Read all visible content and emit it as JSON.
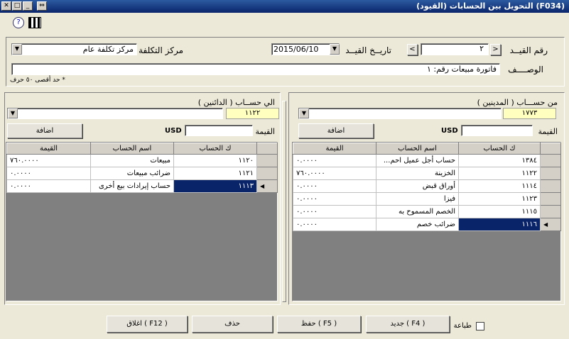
{
  "window": {
    "title": "(F034)  التحويل بين الحسابات (القيود)"
  },
  "header": {
    "entry_no_label": "رقم القيــد",
    "entry_no": "٢",
    "entry_date_label": "تاريــخ القيــد",
    "entry_date": "2015/06/10",
    "cost_center_label": "مركز التكلفة",
    "cost_center": "مركز تكلفة عام",
    "desc_label": "الوصــــف",
    "desc": "فاتورة مبيعات رقم: ١",
    "max_note": "* حد أقصى ٥٠ حرف"
  },
  "right_panel": {
    "title": "من حســـاب ( المدينين )",
    "code": "١٧٧٣",
    "value_label": "القيمة",
    "currency": "USD",
    "add_label": "اضافة",
    "columns": [
      "ك الحساب",
      "اسم الحساب",
      "القيمة"
    ],
    "rows": [
      {
        "code": "١٣٨٤",
        "name": "حساب أجل عميل احم...",
        "value": "٠.٠٠٠٠"
      },
      {
        "code": "١١٢٢",
        "name": "الخزينة",
        "value": "٧٦٠.٠٠٠٠"
      },
      {
        "code": "١١١٤",
        "name": "أوراق قبض",
        "value": "٠.٠٠٠٠"
      },
      {
        "code": "١١٢٣",
        "name": "فيزا",
        "value": "٠.٠٠٠٠"
      },
      {
        "code": "١١١٥",
        "name": "الخصم المسموح به",
        "value": "٠.٠٠٠٠"
      },
      {
        "code": "١١١٦",
        "name": "ضرائب خصم",
        "value": "٠.٠٠٠٠"
      }
    ]
  },
  "left_panel": {
    "title": "الي حســاب ( الدائنين )",
    "code": "١١٢٢",
    "value_label": "القيمة",
    "currency": "USD",
    "add_label": "اضافة",
    "columns": [
      "ك الحساب",
      "اسم الحساب",
      "القيمة"
    ],
    "rows": [
      {
        "code": "١١٢٠",
        "name": "مبيعات",
        "value": "٧٦٠.٠٠٠٠"
      },
      {
        "code": "١١٢١",
        "name": "ضرائب مبيعات",
        "value": "٠.٠٠٠٠"
      },
      {
        "code": "١١١٣",
        "name": "حساب إيرادات بيع أخرى",
        "value": "٠.٠٠٠٠"
      }
    ]
  },
  "footer": {
    "print_label": "طباعة",
    "new_label": "جديد ( F4 )",
    "save_label": "حفظ ( F5 )",
    "delete_label": "حذف",
    "close_label": "اغلاق ( F12 )"
  }
}
